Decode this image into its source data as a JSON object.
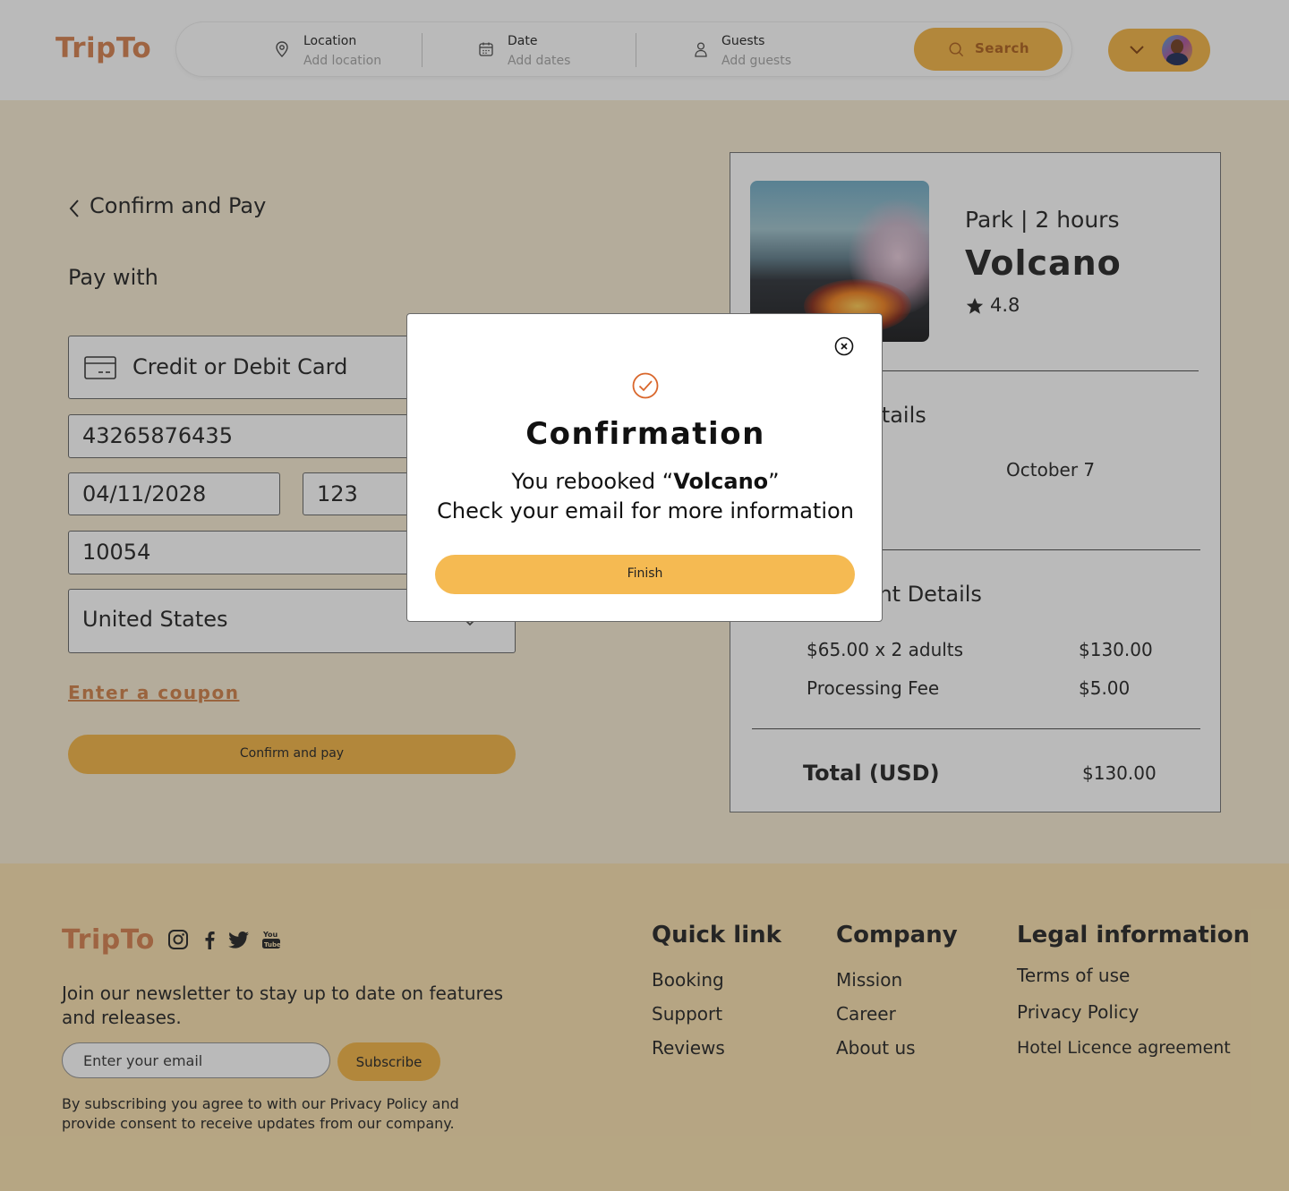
{
  "header": {
    "logo": "TripTo",
    "search": {
      "location_label": "Location",
      "location_placeholder": "Add location",
      "date_label": "Date",
      "date_placeholder": "Add dates",
      "guests_label": "Guests",
      "guests_placeholder": "Add guests",
      "button_label": "Search"
    }
  },
  "checkout": {
    "back_title": "Confirm and Pay",
    "pay_with": "Pay with",
    "payment_method": "Credit or Debit Card",
    "card_number": "43265876435",
    "expiry": "04/11/2028",
    "cvv": "123",
    "zip": "10054",
    "country": "United States",
    "coupon_link": "Enter a coupon",
    "confirm_button": "Confirm and pay"
  },
  "summary": {
    "category": "Park | 2 hours",
    "title": "Volcano",
    "rating": "4.8",
    "details_heading": "Trip Details",
    "date_value": "October 7",
    "payment_heading": "Payment Details",
    "line1_label": "$65.00 x 2 adults",
    "line1_value": "$130.00",
    "line2_label": "Processing Fee",
    "line2_value": "$5.00",
    "total_label": "Total (USD)",
    "total_value": "$130.00"
  },
  "footer": {
    "logo": "TripTo",
    "newsletter": "Join our newsletter to stay up to date on features and releases.",
    "email_placeholder": "Enter your email",
    "subscribe": "Subscribe",
    "consent": "By subscribing you agree to with our Privacy Policy and provide consent to receive updates from our company.",
    "quick_heading": "Quick link",
    "quick_links": [
      "Booking",
      "Support",
      "Reviews"
    ],
    "company_heading": "Company",
    "company_links": [
      "Mission",
      "Career",
      "About us"
    ],
    "legal_heading": "Legal information",
    "legal_links": [
      "Terms of use",
      "Privacy Policy",
      "Hotel Licence agreement"
    ]
  },
  "modal": {
    "title": "Confirmation",
    "line1_prefix": "You rebooked “",
    "line1_name": "Volcano",
    "line1_suffix": "”",
    "line2": "Check your email for more information",
    "finish_button": "Finish"
  },
  "colors": {
    "accent": "#f5ba52",
    "brand": "#d9895b",
    "page_bg": "#f7ecd5",
    "footer_bg": "#fae3b4"
  },
  "icons": [
    "location-pin-icon",
    "calendar-icon",
    "user-icon",
    "search-icon",
    "chevron-down-icon",
    "credit-card-icon",
    "back-chevron-icon",
    "star-icon",
    "instagram-icon",
    "facebook-icon",
    "twitter-icon",
    "youtube-icon",
    "close-icon",
    "check-circle-icon"
  ]
}
